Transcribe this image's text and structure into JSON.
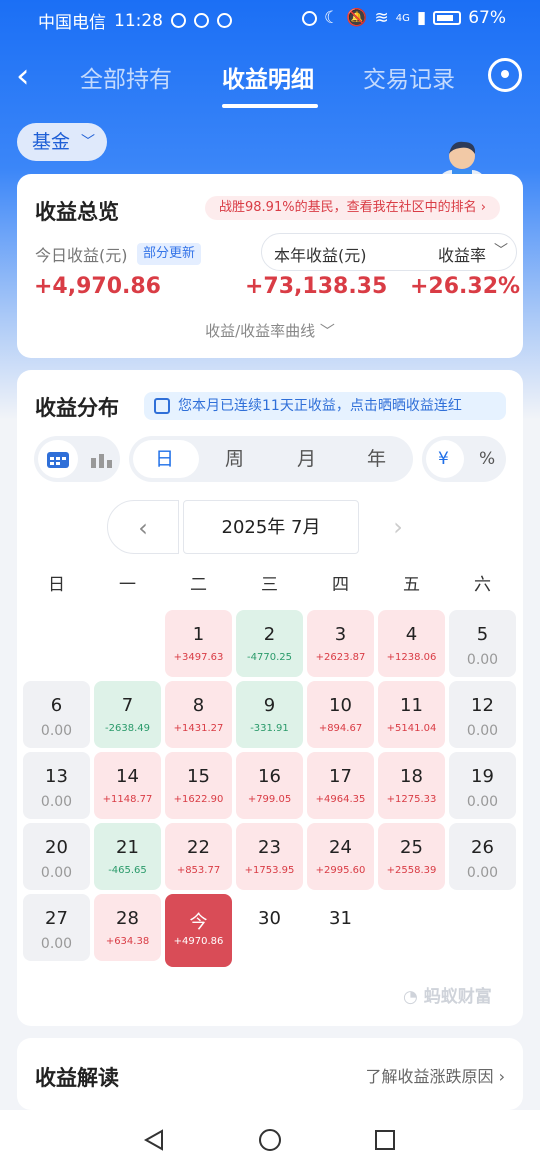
{
  "status_bar": {
    "carrier": "中国电信",
    "time": "11:28",
    "network": "4G",
    "battery": "67%"
  },
  "nav": {
    "tabs": [
      "全部持有",
      "收益明细",
      "交易记录"
    ],
    "active_tab": 1
  },
  "filter_chip": {
    "label": "基金"
  },
  "overview": {
    "title": "收益总览",
    "rank_banner": "战胜98.91%的基民，查看我在社区中的排名",
    "today_label": "今日收益(元)",
    "today_badge": "部分更新",
    "today_value": "+4,970.86",
    "year_label": "本年收益(元)",
    "rate_label": "收益率",
    "year_value": "+73,138.35",
    "rate_value": "+26.32%",
    "curve_link": "收益/收益率曲线"
  },
  "distribution": {
    "title": "收益分布",
    "streak_pill": "您本月已连续11天正收益，点击晒晒收益连红",
    "periods": [
      "日",
      "周",
      "月",
      "年"
    ],
    "active_period": 0,
    "units": [
      "¥",
      "%"
    ],
    "month_label": "2025年 7月",
    "weekdays": [
      "日",
      "一",
      "二",
      "三",
      "四",
      "五",
      "六"
    ],
    "weeks": [
      [
        null,
        null,
        {
          "n": "1",
          "v": "+3497.63",
          "s": "red"
        },
        {
          "n": "2",
          "v": "-4770.25",
          "s": "green"
        },
        {
          "n": "3",
          "v": "+2623.87",
          "s": "red"
        },
        {
          "n": "4",
          "v": "+1238.06",
          "s": "red"
        },
        {
          "n": "5",
          "v": "0.00",
          "s": "zero"
        }
      ],
      [
        {
          "n": "6",
          "v": "0.00",
          "s": "zero"
        },
        {
          "n": "7",
          "v": "-2638.49",
          "s": "green"
        },
        {
          "n": "8",
          "v": "+1431.27",
          "s": "red"
        },
        {
          "n": "9",
          "v": "-331.91",
          "s": "green"
        },
        {
          "n": "10",
          "v": "+894.67",
          "s": "red"
        },
        {
          "n": "11",
          "v": "+5141.04",
          "s": "red"
        },
        {
          "n": "12",
          "v": "0.00",
          "s": "zero"
        }
      ],
      [
        {
          "n": "13",
          "v": "0.00",
          "s": "zero"
        },
        {
          "n": "14",
          "v": "+1148.77",
          "s": "red"
        },
        {
          "n": "15",
          "v": "+1622.90",
          "s": "red"
        },
        {
          "n": "16",
          "v": "+799.05",
          "s": "red"
        },
        {
          "n": "17",
          "v": "+4964.35",
          "s": "red"
        },
        {
          "n": "18",
          "v": "+1275.33",
          "s": "red"
        },
        {
          "n": "19",
          "v": "0.00",
          "s": "zero"
        }
      ],
      [
        {
          "n": "20",
          "v": "0.00",
          "s": "zero"
        },
        {
          "n": "21",
          "v": "-465.65",
          "s": "green"
        },
        {
          "n": "22",
          "v": "+853.77",
          "s": "red"
        },
        {
          "n": "23",
          "v": "+1753.95",
          "s": "red"
        },
        {
          "n": "24",
          "v": "+2995.60",
          "s": "red"
        },
        {
          "n": "25",
          "v": "+2558.39",
          "s": "red"
        },
        {
          "n": "26",
          "v": "0.00",
          "s": "zero"
        }
      ],
      [
        {
          "n": "27",
          "v": "0.00",
          "s": "zero"
        },
        {
          "n": "28",
          "v": "+634.38",
          "s": "red"
        },
        {
          "n": "今",
          "v": "+4970.86",
          "s": "today"
        },
        {
          "n": "30",
          "v": "",
          "s": "blank"
        },
        {
          "n": "31",
          "v": "",
          "s": "blank"
        },
        null,
        null
      ]
    ],
    "watermark": "蚂蚁财富"
  },
  "interpretation": {
    "title": "收益解读",
    "link": "了解收益涨跌原因"
  },
  "colors": {
    "primary": "#1b6ff5",
    "gain": "#d93c45",
    "loss": "#2a9a6a"
  }
}
